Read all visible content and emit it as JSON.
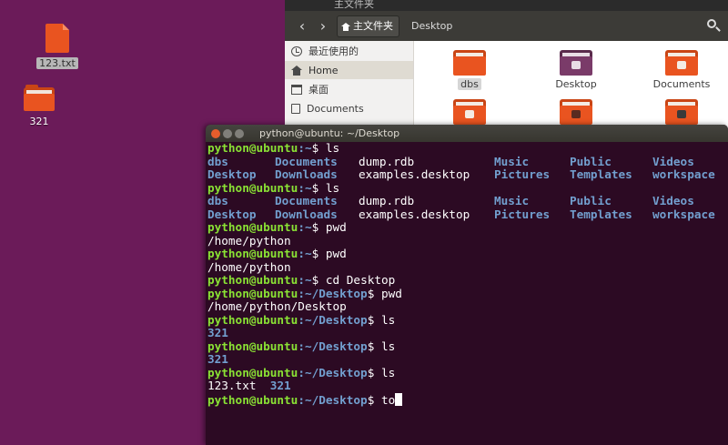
{
  "desktop": {
    "icons": [
      {
        "label": "123.txt",
        "kind": "text-file",
        "selected": true
      },
      {
        "label": "321",
        "kind": "folder"
      }
    ]
  },
  "file_manager": {
    "window_title": "主文件夹",
    "path_home": "主文件夹",
    "path_current": "Desktop",
    "sidebar": [
      {
        "label": "最近使用的",
        "icon": "clock-icon"
      },
      {
        "label": "Home",
        "icon": "home-icon",
        "active": true
      },
      {
        "label": "桌面",
        "icon": "desktop-icon"
      },
      {
        "label": "Documents",
        "icon": "documents-icon"
      }
    ],
    "files": [
      {
        "label": "dbs"
      },
      {
        "label": "Desktop"
      },
      {
        "label": "Documents"
      }
    ]
  },
  "terminal": {
    "title": "python@ubuntu: ~/Desktop",
    "prompt_user": "python@ubuntu",
    "ls_row1": [
      "dbs",
      "Documents",
      "dump.rdb",
      "Music",
      "Public",
      "Videos"
    ],
    "ls_row2": [
      "Desktop",
      "Downloads",
      "examples.desktop",
      "Pictures",
      "Templates",
      "workspace"
    ],
    "lines": {
      "p1_path": ":~",
      "p1_cmd": "$ ls",
      "p2_path": ":~",
      "p2_cmd": "$ ls",
      "p3_path": ":~",
      "p3_cmd": "$ pwd",
      "o3": "/home/python",
      "p4_path": ":~",
      "p4_cmd": "$ pwd",
      "o4": "/home/python",
      "p5_path": ":~",
      "p5_cmd": "$ cd Desktop",
      "p6_path": ":~/Desktop",
      "p6_cmd": "$ pwd",
      "o6": "/home/python/Desktop",
      "p7_path": ":~/Desktop",
      "p7_cmd": "$ ls",
      "o7": "321",
      "p8_path": ":~/Desktop",
      "p8_cmd": "$ ls",
      "o8": "321",
      "p9_path": ":~/Desktop",
      "p9_cmd": "$ ls",
      "o9_file": "123.txt",
      "o9_dir": "321",
      "p10_path": ":~/Desktop",
      "p10_cmd": "$ to"
    }
  }
}
